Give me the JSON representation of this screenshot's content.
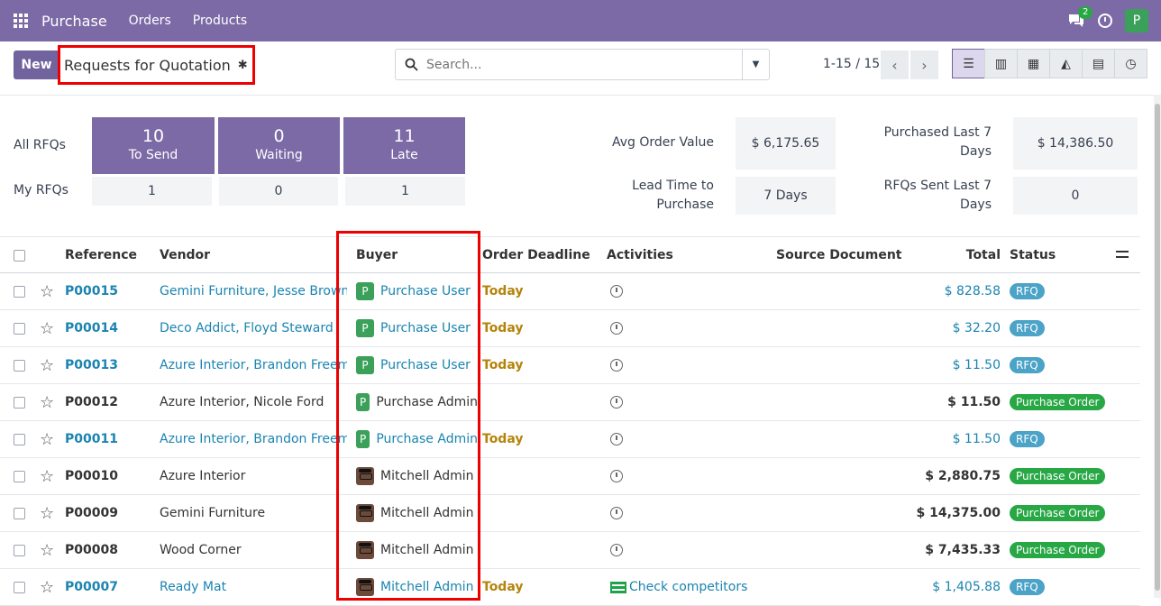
{
  "topbar": {
    "app": "Purchase",
    "menus": [
      "Orders",
      "Products"
    ],
    "chat_count": "2",
    "user_initial": "P"
  },
  "control": {
    "new_label": "New",
    "breadcrumb": "Requests for Quotation",
    "search_placeholder": "Search...",
    "pager": "1-15 / 15"
  },
  "dashboard": {
    "all_rfqs": "All RFQs",
    "my_rfqs": "My RFQs",
    "tiles": [
      {
        "num": "10",
        "label": "To Send",
        "mine": "1"
      },
      {
        "num": "0",
        "label": "Waiting",
        "mine": "0"
      },
      {
        "num": "11",
        "label": "Late",
        "mine": "1"
      }
    ],
    "avg_order_label": "Avg Order Value",
    "avg_order_value": "$ 6,175.65",
    "lead_time_label_1": "Lead Time to",
    "lead_time_label_2": "Purchase",
    "lead_time_value": "7  Days",
    "purchased_label_1": "Purchased Last 7",
    "purchased_label_2": "Days",
    "purchased_value": "$ 14,386.50",
    "rfqs_sent_label_1": "RFQs Sent Last 7",
    "rfqs_sent_label_2": "Days",
    "rfqs_sent_value": "0"
  },
  "table": {
    "headers": {
      "reference": "Reference",
      "vendor": "Vendor",
      "buyer": "Buyer",
      "deadline": "Order Deadline",
      "activities": "Activities",
      "source": "Source Document",
      "total": "Total",
      "status": "Status"
    },
    "rows": [
      {
        "ref": "P00015",
        "vendor": "Gemini Furniture, Jesse Brown",
        "buyer": "Purchase User",
        "avatar": "P",
        "deadline": "Today",
        "activity": "",
        "total": "$ 828.58",
        "status": "RFQ"
      },
      {
        "ref": "P00014",
        "vendor": "Deco Addict, Floyd Steward",
        "buyer": "Purchase User",
        "avatar": "P",
        "deadline": "Today",
        "activity": "",
        "total": "$ 32.20",
        "status": "RFQ"
      },
      {
        "ref": "P00013",
        "vendor": "Azure Interior, Brandon Freeman",
        "buyer": "Purchase User",
        "avatar": "P",
        "deadline": "Today",
        "activity": "",
        "total": "$ 11.50",
        "status": "RFQ"
      },
      {
        "ref": "P00012",
        "vendor": "Azure Interior, Nicole Ford",
        "buyer": "Purchase Admin",
        "avatar": "P",
        "deadline": "",
        "activity": "",
        "total": "$ 11.50",
        "status": "Purchase Order"
      },
      {
        "ref": "P00011",
        "vendor": "Azure Interior, Brandon Freeman",
        "buyer": "Purchase Admin",
        "avatar": "P",
        "deadline": "Today",
        "activity": "",
        "total": "$ 11.50",
        "status": "RFQ"
      },
      {
        "ref": "P00010",
        "vendor": "Azure Interior",
        "buyer": "Mitchell Admin",
        "avatar": "",
        "deadline": "",
        "activity": "",
        "total": "$ 2,880.75",
        "status": "Purchase Order"
      },
      {
        "ref": "P00009",
        "vendor": "Gemini Furniture",
        "buyer": "Mitchell Admin",
        "avatar": "",
        "deadline": "",
        "activity": "",
        "total": "$ 14,375.00",
        "status": "Purchase Order"
      },
      {
        "ref": "P00008",
        "vendor": "Wood Corner",
        "buyer": "Mitchell Admin",
        "avatar": "",
        "deadline": "",
        "activity": "",
        "total": "$ 7,435.33",
        "status": "Purchase Order"
      },
      {
        "ref": "P00007",
        "vendor": "Ready Mat",
        "buyer": "Mitchell Admin",
        "avatar": "",
        "deadline": "Today",
        "activity": "Check competitors",
        "total": "$ 1,405.88",
        "status": "RFQ"
      }
    ]
  },
  "colors": {
    "brand": "#7c6aa6",
    "link": "#1a84b0",
    "rfq": "#4ba3c7",
    "po": "#28a745",
    "highlight": "#e00000"
  }
}
